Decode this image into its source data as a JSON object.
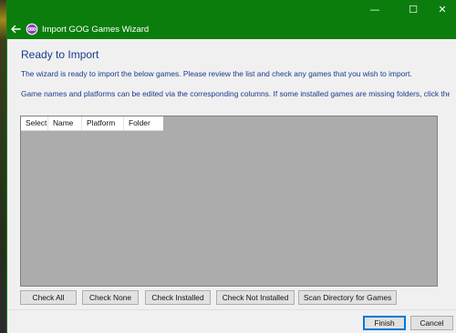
{
  "window": {
    "controls": {
      "minimize": "—",
      "maximize": "☐",
      "close": "✕"
    },
    "title_bar_color": "#0a7d0c"
  },
  "header": {
    "title": "Import GOG Games Wizard",
    "back_icon": "back-arrow-icon",
    "app_icon": "gog-icon"
  },
  "main": {
    "heading": "Ready to Import",
    "paragraph1": "The wizard is ready to import the below games. Please review the list and check any games that you wish to import.",
    "paragraph2": "Game names and platforms can be edited via the corresponding columns. If some installed games are missing folders, click the",
    "grid": {
      "columns": [
        "Select",
        "Name",
        "Platform",
        "Folder"
      ],
      "rows": []
    },
    "actions": {
      "check_all": "Check All",
      "check_none": "Check None",
      "check_installed": "Check Installed",
      "check_not_installed": "Check Not Installed",
      "scan_directory": "Scan Directory for Games"
    }
  },
  "footer": {
    "finish": "Finish",
    "cancel": "Cancel"
  },
  "colors": {
    "accent": "#0a7d0c",
    "heading_text": "#1a3a8c",
    "grid_background": "#acacac",
    "default_button_border": "#0078d7"
  }
}
